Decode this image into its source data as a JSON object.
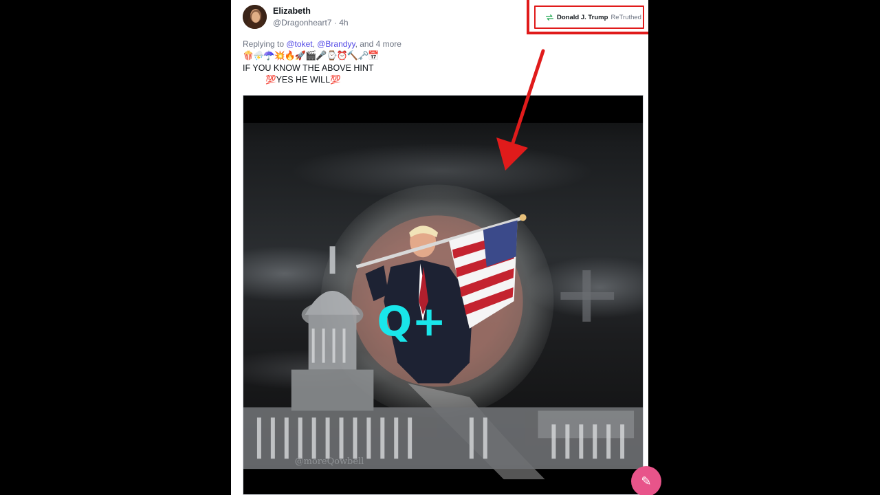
{
  "post": {
    "author_name": "Elizabeth",
    "author_handle": "@Dragonheart7 · 4h",
    "reply_prefix": "Replying to ",
    "reply_mention_1": "@toket",
    "reply_sep": ", ",
    "reply_mention_2": "@Brandyy",
    "reply_suffix": ", and 4 more",
    "emojis": "🍿⛈️☂️💥🔥🚀🎬🎤⌚⏰🔨🗝️📅",
    "text_line_1": "IF YOU KNOW THE ABOVE HINT",
    "text_line_2": "💯YES HE WILL💯"
  },
  "retruth": {
    "icon": "retruth-icon",
    "name": "Donald J. Trump",
    "label": "ReTruthed"
  },
  "media": {
    "overlay_text": "Q+",
    "watermark": "@moreQowbell"
  },
  "colors": {
    "annotation_red": "#e01b1b",
    "mention": "#4f46e5",
    "retruth_green": "#16a34a",
    "fab_pink": "#e8548a",
    "q_cyan": "#19e6ea"
  },
  "fab": {
    "icon": "compose-icon"
  }
}
